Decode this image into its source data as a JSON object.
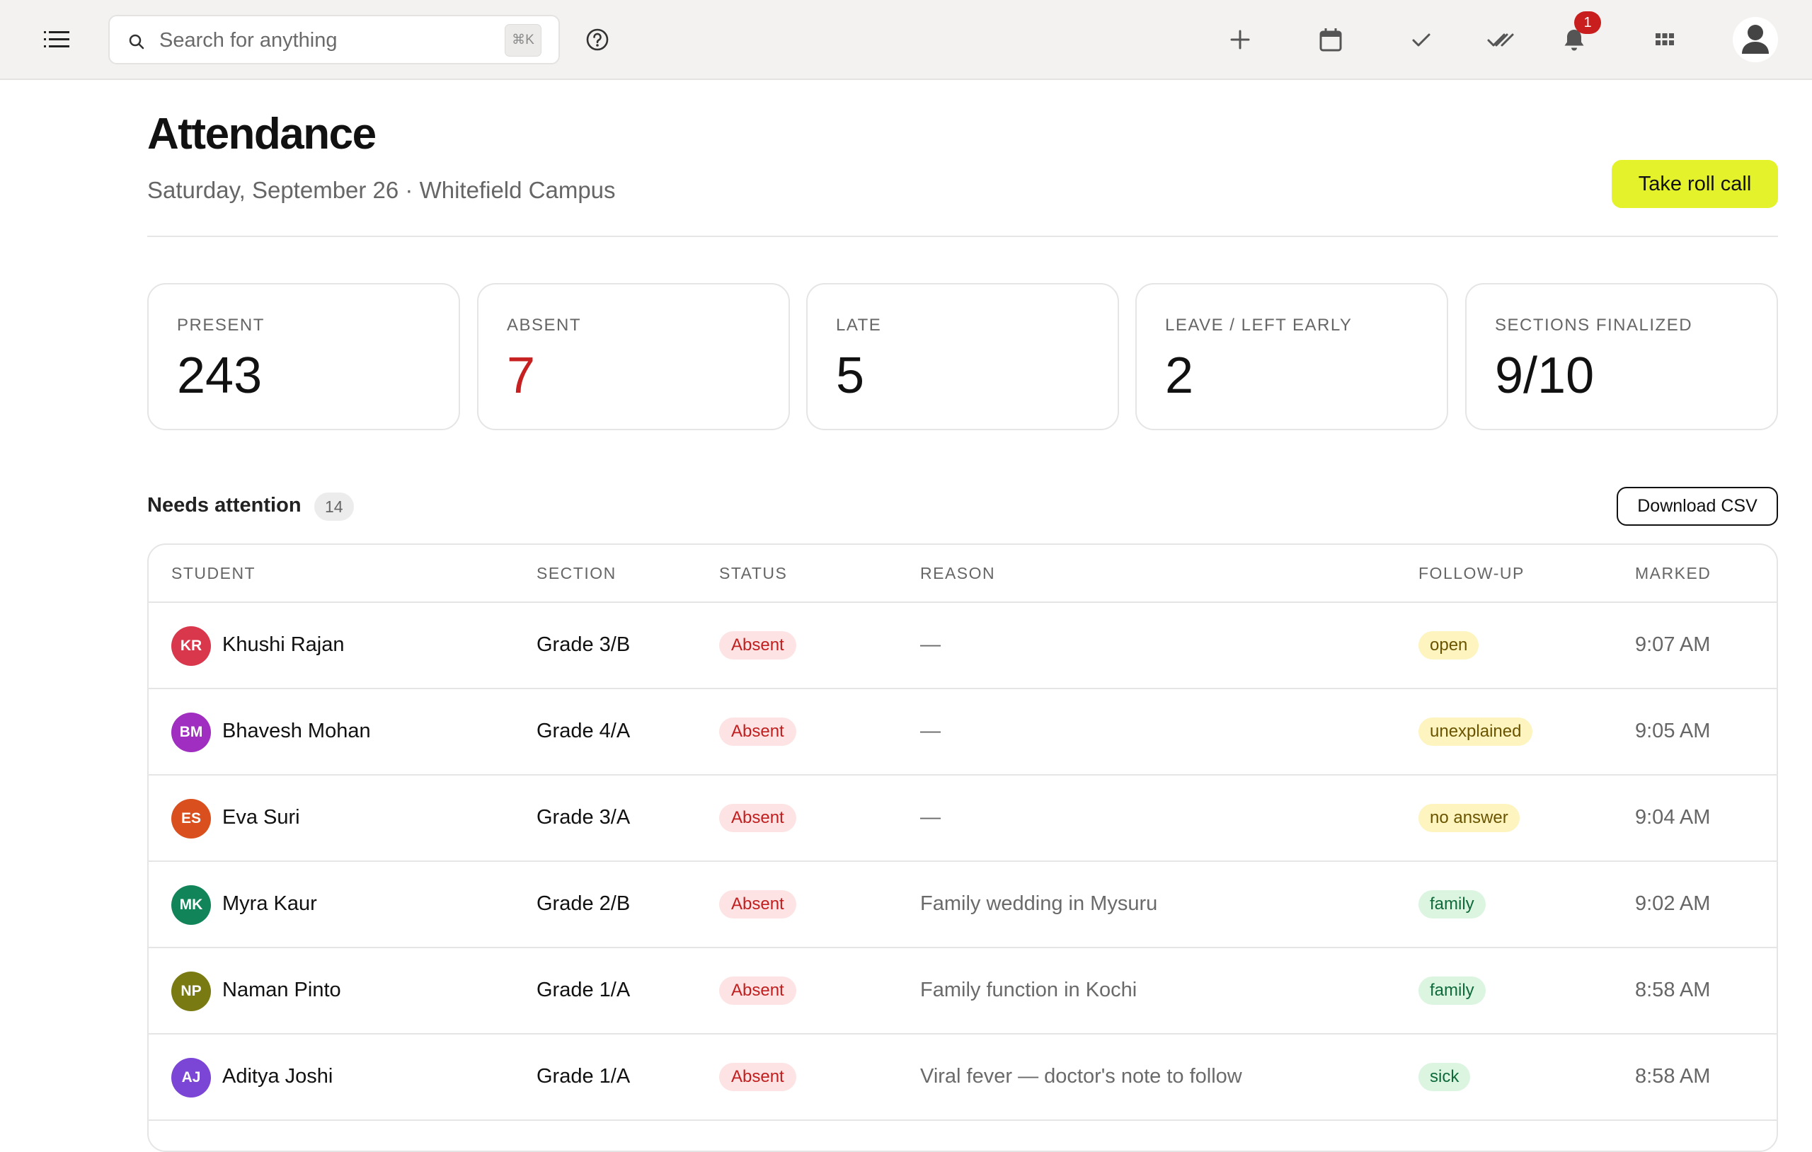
{
  "topbar": {
    "search_placeholder": "Search for anything",
    "search_shortcut": "⌘K",
    "notification_count": "1",
    "icons": [
      "menu-icon",
      "search-icon",
      "help-icon",
      "plus-icon",
      "calendar-icon",
      "check-icon",
      "double-check-icon",
      "bell-icon",
      "apps-grid-icon",
      "user-avatar-icon"
    ]
  },
  "header": {
    "title": "Attendance",
    "subtitle": "Saturday, September 26 · Whitefield Campus",
    "primary_button": "Take roll call"
  },
  "stats": [
    {
      "label": "PRESENT",
      "value": "243"
    },
    {
      "label": "ABSENT",
      "value": "7"
    },
    {
      "label": "LATE",
      "value": "5"
    },
    {
      "label": "LEAVE / LEFT EARLY",
      "value": "2"
    },
    {
      "label": "SECTIONS FINALIZED",
      "value": "9/10"
    }
  ],
  "attention": {
    "title": "Needs attention",
    "count": "14",
    "download_button": "Download CSV",
    "columns": [
      "STUDENT",
      "SECTION",
      "STATUS",
      "REASON",
      "FOLLOW-UP",
      "MARKED"
    ],
    "rows": [
      {
        "initials": "KR",
        "name": "Khushi Rajan",
        "section": "Grade 3/B",
        "status": "Absent",
        "reason": "—",
        "followup": "open",
        "marked": "9:07 AM"
      },
      {
        "initials": "BM",
        "name": "Bhavesh Mohan",
        "section": "Grade 4/A",
        "status": "Absent",
        "reason": "—",
        "followup": "unexplained",
        "marked": "9:05 AM"
      },
      {
        "initials": "ES",
        "name": "Eva Suri",
        "section": "Grade 3/A",
        "status": "Absent",
        "reason": "—",
        "followup": "no answer",
        "marked": "9:04 AM"
      },
      {
        "initials": "MK",
        "name": "Myra Kaur",
        "section": "Grade 2/B",
        "status": "Absent",
        "reason": "Family wedding in Mysuru",
        "followup": "family",
        "marked": "9:02 AM"
      },
      {
        "initials": "NP",
        "name": "Naman Pinto",
        "section": "Grade 1/A",
        "status": "Absent",
        "reason": "Family function in Kochi",
        "followup": "family",
        "marked": "8:58 AM"
      },
      {
        "initials": "AJ",
        "name": "Aditya Joshi",
        "section": "Grade 1/A",
        "status": "Absent",
        "reason": "Viral fever — doctor's note to follow",
        "followup": "sick",
        "marked": "8:58 AM"
      }
    ]
  },
  "colors": {
    "accent_button": "#e4f22b",
    "absent_red": "#c62020",
    "badge_red": "#c81e1e",
    "avatars": [
      "#d9374b",
      "#a02ec0",
      "#d9501e",
      "#11845a",
      "#7a7a12",
      "#7b45d6"
    ],
    "followup_yellow_bg": "#fdf4bf",
    "followup_yellow_fg": "#6b5400",
    "followup_green_bg": "#dcf5e1",
    "followup_green_fg": "#0f6a3a"
  }
}
